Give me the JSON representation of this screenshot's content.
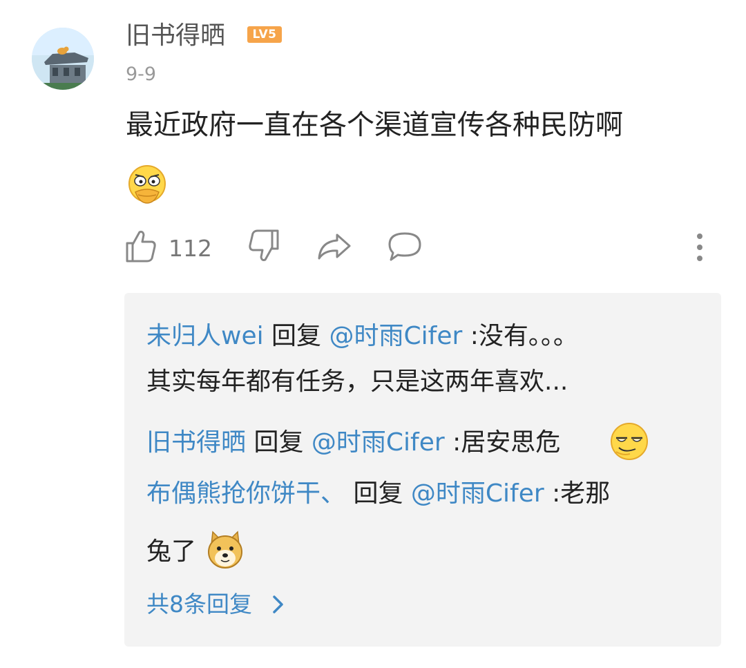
{
  "comment": {
    "username": "旧书得晒",
    "level": "LV5",
    "date": "9-9",
    "text": "最近政府一直在各个渠道宣传各种民防啊",
    "emoji_icon": "duck-emoji-icon",
    "likes": "112"
  },
  "replies": [
    {
      "user": "未归人wei",
      "action": " 回复 ",
      "target": "@时雨Cifer",
      "text_line1": " :没有。。。",
      "text_line2": "其实每年都有任务，只是这两年喜欢..."
    },
    {
      "user": "旧书得晒",
      "action": " 回复 ",
      "target": "@时雨Cifer",
      "text": " :居安思危",
      "emoji_icon": "smug-face-emoji-icon"
    },
    {
      "user": "布偶熊抢你饼干、",
      "action": " 回复 ",
      "target": "@时雨Cifer",
      "text_line1": " :老那",
      "text_line2": "兔了",
      "emoji_icon": "doge-emoji-icon"
    }
  ],
  "more_replies_label": "共8条回复",
  "colors": {
    "link_blue": "#3f88c5",
    "badge_orange": "#f6a44a",
    "reply_bg": "#f3f3f3"
  }
}
